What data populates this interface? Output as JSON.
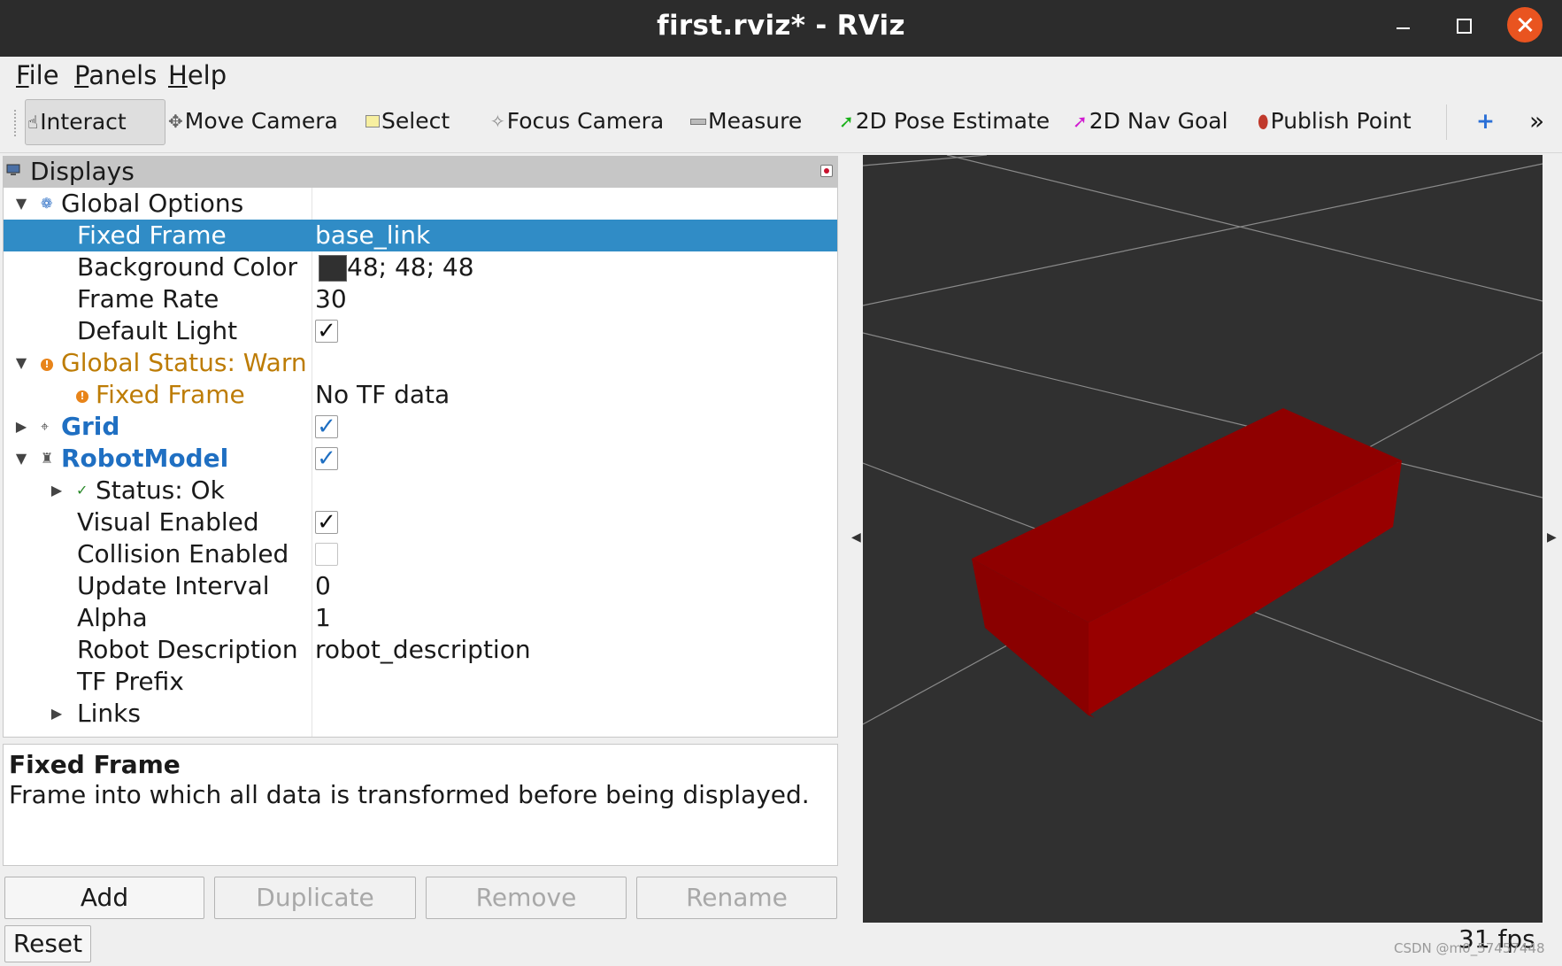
{
  "window": {
    "title": "first.rviz* - RViz"
  },
  "menu": {
    "file": {
      "accel": "F",
      "rest": "ile"
    },
    "panels": {
      "accel": "P",
      "rest": "anels"
    },
    "help": {
      "accel": "H",
      "rest": "elp"
    }
  },
  "toolbar": {
    "tools": [
      {
        "label": "Interact",
        "icon": "hand-icon",
        "active": true
      },
      {
        "label": "Move Camera",
        "icon": "move-camera-icon"
      },
      {
        "label": "Select",
        "icon": "select-icon"
      },
      {
        "label": "Focus Camera",
        "icon": "focus-camera-icon"
      },
      {
        "label": "Measure",
        "icon": "measure-icon"
      },
      {
        "label": "2D Pose Estimate",
        "icon": "green-arrow-icon"
      },
      {
        "label": "2D Nav Goal",
        "icon": "magenta-arrow-icon"
      },
      {
        "label": "Publish Point",
        "icon": "map-pin-icon"
      }
    ],
    "add_symbol": "+",
    "overflow_symbol": "»"
  },
  "displays": {
    "title": "Displays",
    "global_options": {
      "label": "Global Options",
      "fixed_frame": {
        "label": "Fixed Frame",
        "value": "base_link"
      },
      "background_color": {
        "label": "Background Color",
        "value": "48; 48; 48",
        "swatch": "#303030"
      },
      "frame_rate": {
        "label": "Frame Rate",
        "value": "30"
      },
      "default_light": {
        "label": "Default Light",
        "checked": true
      }
    },
    "global_status": {
      "label": "Global Status: Warn",
      "fixed_frame": {
        "label": "Fixed Frame",
        "value": "No TF data"
      }
    },
    "grid": {
      "label": "Grid",
      "checked": true
    },
    "robot_model": {
      "label": "RobotModel",
      "checked": true,
      "status": {
        "label": "Status: Ok"
      },
      "visual_enabled": {
        "label": "Visual Enabled",
        "checked": true
      },
      "collision_enabled": {
        "label": "Collision Enabled",
        "checked": false
      },
      "update_interval": {
        "label": "Update Interval",
        "value": "0"
      },
      "alpha": {
        "label": "Alpha",
        "value": "1"
      },
      "robot_description": {
        "label": "Robot Description",
        "value": "robot_description"
      },
      "tf_prefix": {
        "label": "TF Prefix",
        "value": ""
      },
      "links": {
        "label": "Links"
      }
    },
    "check_mark": "✓"
  },
  "description": {
    "title": "Fixed Frame",
    "text": "Frame into which all data is transformed before being displayed."
  },
  "buttons": {
    "add": "Add",
    "duplicate": "Duplicate",
    "remove": "Remove",
    "rename": "Rename",
    "reset": "Reset"
  },
  "status": {
    "fps": "31 fps"
  },
  "watermark": "CSDN @m0_57457448",
  "colors": {
    "selection": "#308cc6",
    "warning": "#bd7c05",
    "display_name": "#1f6fc2",
    "viewport_background": "#303030",
    "robot_box": "#990000",
    "close_button": "#e95420"
  }
}
